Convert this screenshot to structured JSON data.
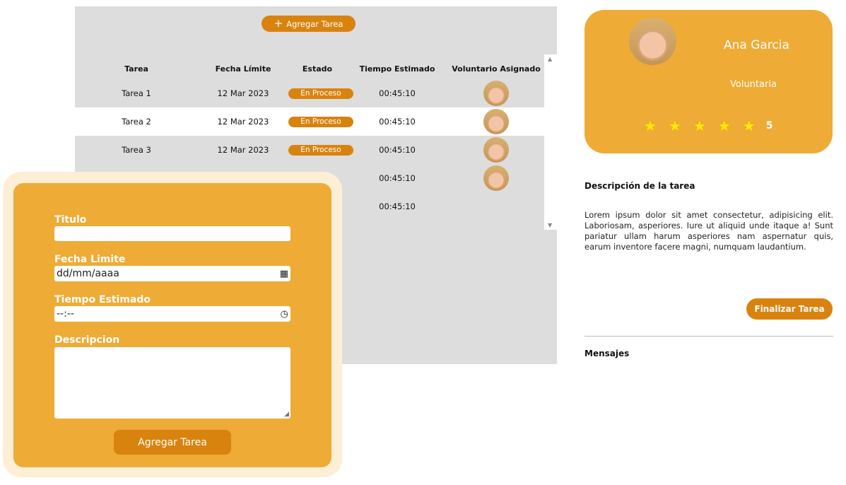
{
  "colors": {
    "accent": "#eeab36",
    "button": "#d9830f",
    "panel": "#dddddd",
    "star": "#ffeb00"
  },
  "panel": {
    "add_button_label": "Agregar Tarea",
    "add_button_icon": "plus-icon",
    "columns": [
      "Tarea",
      "Fecha Límite",
      "Estado",
      "Tiempo Estimado",
      "Voluntario Asignado"
    ],
    "rows": [
      {
        "task": "Tarea 1",
        "due": "12 Mar 2023",
        "status": "En Proceso",
        "time": "00:45:10"
      },
      {
        "task": "Tarea 2",
        "due": "12 Mar 2023",
        "status": "En Proceso",
        "time": "00:45:10"
      },
      {
        "task": "Tarea 3",
        "due": "12 Mar 2023",
        "status": "En Proceso",
        "time": "00:45:10"
      },
      {
        "task": "",
        "due": "",
        "status": "",
        "time": "00:45:10"
      },
      {
        "task": "",
        "due": "",
        "status": "",
        "time": "00:45:10"
      }
    ]
  },
  "form": {
    "title_label": "Titulo",
    "title_value": "",
    "due_label": "Fecha Limite",
    "due_placeholder": "dd/mm/aaaa",
    "time_label": "Tiempo Estimado",
    "time_placeholder": "--:--",
    "desc_label": "Descripcion",
    "submit_label": "Agregar Tarea"
  },
  "profile": {
    "name": "Ana Garcia",
    "role": "Voluntaria",
    "rating": "5",
    "stars_filled": 5
  },
  "details": {
    "desc_title": "Descripción de la tarea",
    "desc_text": "Lorem ipsum dolor sit amet consectetur, adipisicing elit. Laboriosam, asperiores. Iure ut aliquid unde itaque a! Sunt pariatur ullam harum asperiores nam aspernatur quis, earum inventore facere magni, numquam laudantium.",
    "finish_label": "Finalizar Tarea",
    "messages_title": "Mensajes"
  }
}
